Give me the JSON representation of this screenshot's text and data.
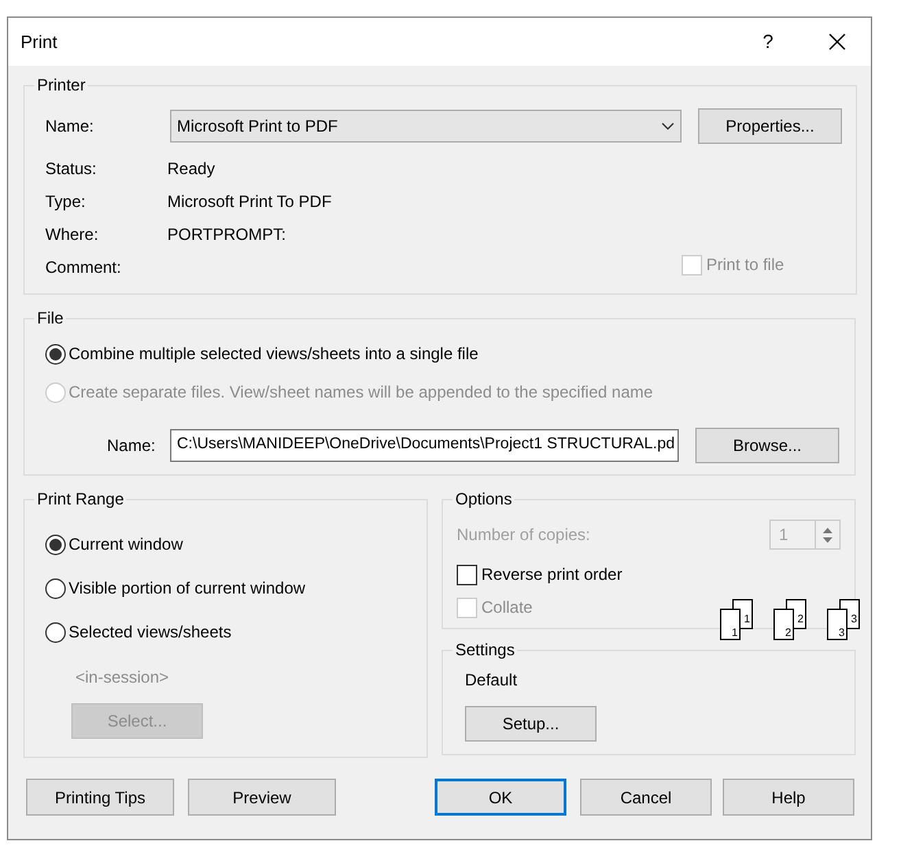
{
  "window": {
    "title": "Print",
    "help": "?"
  },
  "printer": {
    "title": "Printer",
    "name_label": "Name:",
    "name_value": "Microsoft Print to PDF",
    "properties_button": "Properties...",
    "details": [
      {
        "label": "Status:",
        "value": "Ready"
      },
      {
        "label": "Type:",
        "value": "Microsoft Print To PDF"
      },
      {
        "label": "Where:",
        "value": "PORTPROMPT:"
      },
      {
        "label": "Comment:"
      }
    ],
    "print_to_file": {
      "label": "Print to file",
      "checked": false,
      "disabled": true
    }
  },
  "file": {
    "title": "File",
    "options": [
      {
        "label": "Combine multiple selected views/sheets into a single file",
        "selected": true,
        "disabled": false
      },
      {
        "label": "Create separate files. View/sheet names will be appended to the specified name",
        "selected": false,
        "disabled": true
      }
    ],
    "name_label": "Name:",
    "name_value": "C:\\Users\\MANIDEEP\\OneDrive\\Documents\\Project1 STRUCTURAL.pd",
    "browse_button": "Browse..."
  },
  "print_range": {
    "title": "Print Range",
    "options": [
      {
        "label": "Current window",
        "selected": true
      },
      {
        "label": "Visible portion of current window",
        "selected": false
      },
      {
        "label": "Selected views/sheets",
        "selected": false
      }
    ],
    "session": "<in-session>",
    "select_button": {
      "label": "Select...",
      "disabled": true
    }
  },
  "options": {
    "title": "Options",
    "copies_label": "Number of copies:",
    "copies_value": "1",
    "copies_disabled": true,
    "reverse": {
      "label": "Reverse print order",
      "checked": false,
      "disabled": false
    },
    "collate": {
      "label": "Collate",
      "checked": false,
      "disabled": true
    },
    "collate_preview": [
      {
        "back": "1",
        "front": "1"
      },
      {
        "back": "2",
        "front": "2"
      },
      {
        "back": "3",
        "front": "3"
      }
    ]
  },
  "settings": {
    "title": "Settings",
    "value": "Default",
    "setup_button": "Setup..."
  },
  "buttons": [
    {
      "label": "Printing Tips",
      "default": false
    },
    {
      "label": "Preview",
      "default": false
    },
    {
      "label": "OK",
      "default": true
    },
    {
      "label": "Cancel",
      "default": false
    },
    {
      "label": "Help",
      "default": false
    }
  ]
}
